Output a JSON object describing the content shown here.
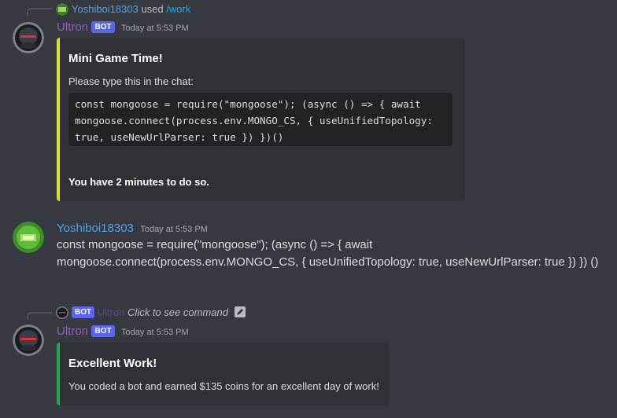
{
  "messages": [
    {
      "reply": {
        "user": "Yoshiboi18303",
        "action": "used",
        "command": "/work"
      },
      "author": "Ultron",
      "tag": "BOT",
      "time": "Today at 5:53 PM",
      "embed": {
        "color": "#e1e11e",
        "title": "Mini Game Time!",
        "description": "Please type this in the chat:",
        "code": "const mongoose = require(\"mongoose\"); (async () => { await mongoose.connect(process.env.MONGO_CS, { useUnifiedTopology: true, useNewUrlParser: true }) })()",
        "footer_bold": "You have 2 minutes to do so."
      }
    },
    {
      "author": "Yoshiboi18303",
      "time": "Today at 5:53 PM",
      "content": "const mongoose = require(\"mongoose\"); (async () => { await mongoose.connect(process.env.MONGO_CS, { useUnifiedTopology: true, useNewUrlParser: true }) }) ()"
    },
    {
      "reply": {
        "tag": "BOT",
        "user": "Ultron",
        "hint": "Click to see command"
      },
      "author": "Ultron",
      "tag": "BOT",
      "time": "Today at 5:53 PM",
      "embed": {
        "color": "#24a84b",
        "title": "Excellent Work!",
        "description": "You coded a bot and earned $135 coins for an excellent day of work!"
      }
    }
  ]
}
